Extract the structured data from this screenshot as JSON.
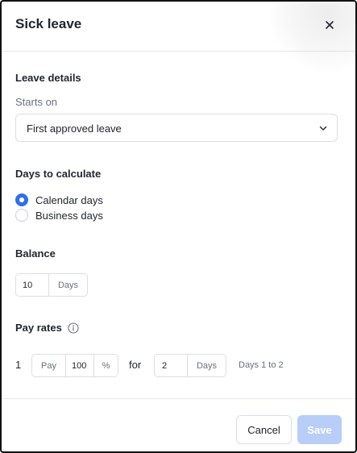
{
  "dialog": {
    "title": "Sick leave",
    "close_icon": "close-icon"
  },
  "leave_details": {
    "heading": "Leave details",
    "starts_on_label": "Starts on",
    "starts_on_value": "First approved leave",
    "chevron_icon": "chevron-down-icon"
  },
  "days_to_calculate": {
    "heading": "Days to calculate",
    "options": [
      {
        "label": "Calendar days",
        "checked": true
      },
      {
        "label": "Business days",
        "checked": false
      }
    ]
  },
  "balance": {
    "heading": "Balance",
    "value": "10",
    "unit": "Days"
  },
  "pay_rates": {
    "heading": "Pay rates",
    "info_icon": "info-icon",
    "rows": [
      {
        "index": "1",
        "pay_label": "Pay",
        "pay_value": "100",
        "pay_unit": "%",
        "for_text": "for",
        "days_value": "2",
        "days_unit": "Days",
        "range_text": "Days 1 to 2"
      }
    ]
  },
  "footer": {
    "cancel_label": "Cancel",
    "save_label": "Save",
    "save_enabled": false
  },
  "colors": {
    "accent": "#2f6fea",
    "save_disabled": "#b8cdf7",
    "border": "#dcdee4",
    "muted_text": "#6b7080"
  }
}
